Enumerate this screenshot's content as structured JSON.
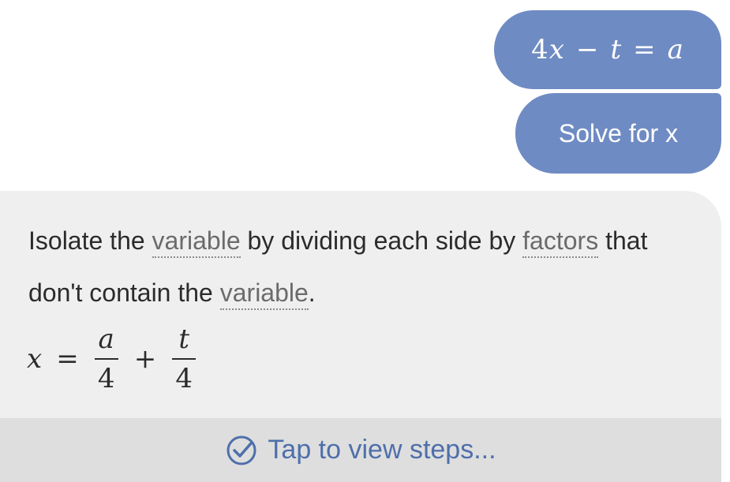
{
  "conversation": {
    "equation_bubble": {
      "coefficient": "4",
      "var_x": "x",
      "minus": "−",
      "var_t": "t",
      "equals": "=",
      "var_a": "a"
    },
    "request_bubble": {
      "label": "Solve for x"
    },
    "answer": {
      "text_1": "Isolate the ",
      "term_1": "variable",
      "text_2": " by dividing each side by ",
      "term_2": "factors",
      "text_3": " that don't contain the ",
      "term_3": "variable",
      "text_4": ".",
      "formula": {
        "lhs": "x",
        "equals": "=",
        "frac1_num": "a",
        "frac1_den": "4",
        "plus": "+",
        "frac2_num": "t",
        "frac2_den": "4"
      }
    },
    "steps_button": {
      "label": "Tap to view steps...",
      "icon": "check-circle-icon"
    }
  },
  "colors": {
    "user_bubble": "#6f8bc3",
    "answer_background": "#efefef",
    "steps_background": "#dedede",
    "steps_text": "#4e6fab"
  }
}
